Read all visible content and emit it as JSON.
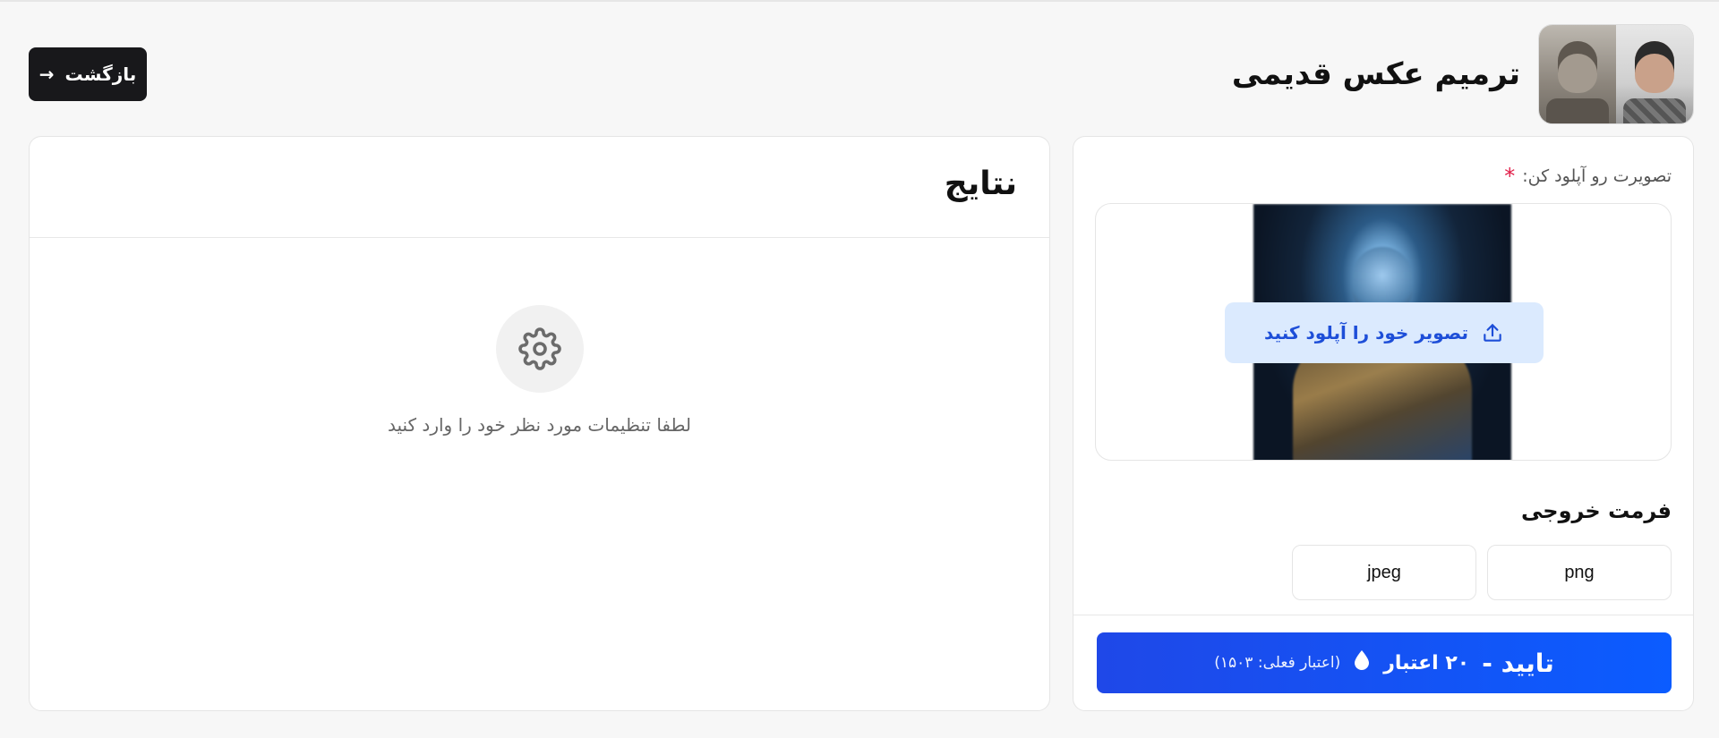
{
  "header": {
    "title": "ترمیم عکس قدیمی",
    "back_label": "بازگشت",
    "back_icon": "arrow-right-icon",
    "thumbnail_icon": "before-after-thumbnail"
  },
  "upload": {
    "label": "تصویرت رو آپلود کن:",
    "required_mark": "*",
    "button_label": "تصویر خود را آپلود کنید",
    "button_icon": "upload-icon"
  },
  "format": {
    "title": "فرمت خروجی",
    "options": [
      "png",
      "jpeg"
    ]
  },
  "submit": {
    "label": "تایید -",
    "cost": "۲۰ اعتبار",
    "current_credit": "(اعتبار فعلی: ۱۵۰۳)",
    "icon": "drop-icon"
  },
  "results": {
    "title": "نتایج",
    "empty_icon": "gear-icon",
    "empty_text": "لطفا تنظیمات مورد نظر خود را وارد کنید"
  },
  "colors": {
    "primary": "#0b5cff",
    "dark_button": "#18181b",
    "upload_button_bg": "#dbeafe",
    "required": "#e11d48"
  }
}
